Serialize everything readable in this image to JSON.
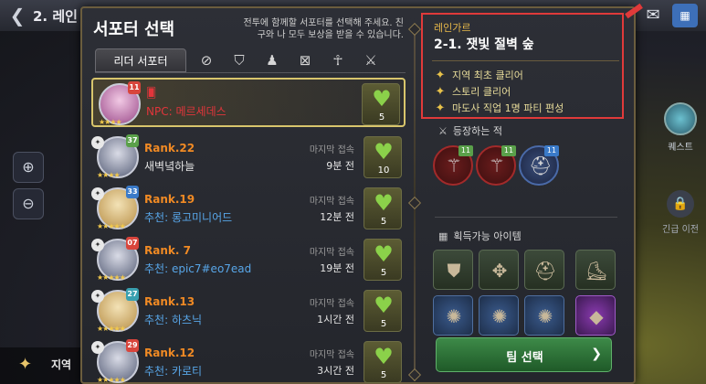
{
  "background": {
    "title": "2. 레인",
    "bottom_label": "지역"
  },
  "panel": {
    "title": "서포터 선택",
    "description": "전투에 함께할 서포터를 선택해 주세요. 친구와 나 모두 보상을 받을 수 있습니다.",
    "tabs": {
      "active_label": "리더 서포터",
      "icons": [
        "no-element-icon",
        "shield-icon",
        "hooded-figure-icon",
        "crossed-frame-icon",
        "mage-icon",
        "slash-icon"
      ]
    }
  },
  "supporters": [
    {
      "level": "11",
      "rank": "",
      "name": "NPC: 메르세데스",
      "npc": true,
      "last_label": "",
      "last_value": "",
      "hearts": "5"
    },
    {
      "level": "37",
      "rank": "Rank.22",
      "name": "새벽녘하늘",
      "npc": false,
      "last_label": "마지막 접속",
      "last_value": "9분 전",
      "hearts": "10"
    },
    {
      "level": "33",
      "rank": "Rank.19",
      "name": "추천: 롱고미니어드",
      "npc": false,
      "last_label": "마지막 접속",
      "last_value": "12분 전",
      "hearts": "5"
    },
    {
      "level": "07",
      "rank": "Rank.  7",
      "name": "추천: epic7#eo7ead",
      "npc": false,
      "last_label": "마지막 접속",
      "last_value": "19분 전",
      "hearts": "5"
    },
    {
      "level": "27",
      "rank": "Rank.13",
      "name": "추천: 하츠닉",
      "npc": false,
      "last_label": "마지막 접속",
      "last_value": "1시간 전",
      "hearts": "5"
    },
    {
      "level": "29",
      "rank": "Rank.12",
      "name": "추천: 카로티",
      "npc": false,
      "last_label": "마지막 접속",
      "last_value": "3시간 전",
      "hearts": "5"
    }
  ],
  "stage": {
    "region": "레인가르",
    "name": "2-1. 잿빛 절벽 숲",
    "missions": [
      "지역 최초 클리어",
      "스토리 클리어",
      "마도사 직업 1명 파티 편성"
    ]
  },
  "enemies": {
    "title": "등장하는 적",
    "badges": [
      "11",
      "11",
      "11"
    ]
  },
  "items": {
    "title": "획득가능 아이템"
  },
  "team_button": {
    "label": "팀 선택"
  },
  "right_side": {
    "quest_label": "퀘스트",
    "lock_label": "긴급 이전"
  },
  "colors": {
    "rank": "#f08a24",
    "recommend": "#58a6e8",
    "npc": "#e2353b",
    "heart": "#8bd14a",
    "highlight_box": "#e03a3a",
    "button": "#3d8a48"
  }
}
